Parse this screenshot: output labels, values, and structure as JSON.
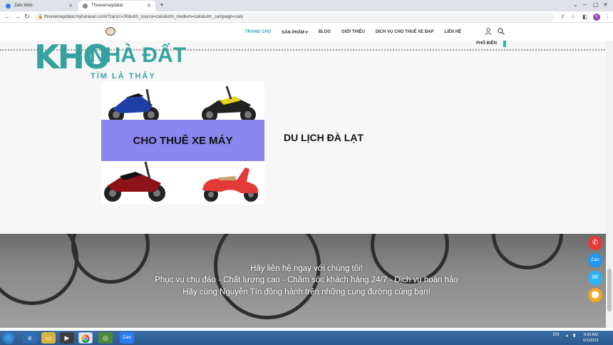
{
  "browser": {
    "tabs": [
      {
        "label": "Zalo Web",
        "active": false
      },
      {
        "label": "Thuexemaydalat",
        "active": true
      }
    ],
    "new_tab": "+",
    "url": "thuexemaydalat.myharavan.com/?zarsrc=30&utm_source=zalo&utm_medium=zalo&utm_campaign=zalo",
    "profile_initial": "K"
  },
  "site": {
    "nav": [
      {
        "label": "TRANG CHỦ",
        "active": true
      },
      {
        "label": "SẢN PHẨM ▾",
        "active": false
      },
      {
        "label": "BLOG",
        "active": false
      },
      {
        "label": "GIỚI THIỆU",
        "active": false
      },
      {
        "label": "DỊCH VỤ CHO THUÊ XE ĐẠP",
        "active": false
      },
      {
        "label": "LIÊN HỆ",
        "active": false
      }
    ],
    "pho_bien": "PHỔ BIẾN"
  },
  "watermark": {
    "kho": "KHO",
    "nha_dat": "NHÀ ĐẤT",
    "tagline": "TÌM LÀ THẤY"
  },
  "promo": {
    "image_text": "CHO THUÊ XE MÁY",
    "section_title": "DU LỊCH ĐÀ LẠT"
  },
  "banner": {
    "line1": "Hãy liên hệ ngay với chúng tôi!",
    "line2": "Phục vụ chu đáo - Chất lượng cao - Chăm sóc khách hàng 24/7 - Dịch vụ hoàn hảo",
    "line3": "Hãy cùng Nguyễn Tín đồng hành trên những cung đường cùng bạn!"
  },
  "fabs": [
    {
      "icon": "phone-icon",
      "color": "#e53935"
    },
    {
      "icon": "zalo-icon",
      "color": "#2196f3"
    },
    {
      "icon": "mail-icon",
      "color": "#29b6f6"
    },
    {
      "icon": "map-pin-icon",
      "color": "#f5a623"
    }
  ],
  "taskbar": {
    "lang": "EN",
    "time": "9:43 AM",
    "date": "6/1/2023"
  },
  "colors": {
    "accent": "#26a9b8",
    "watermark": "#36a2a0",
    "promo_band": "#8b86f0"
  }
}
